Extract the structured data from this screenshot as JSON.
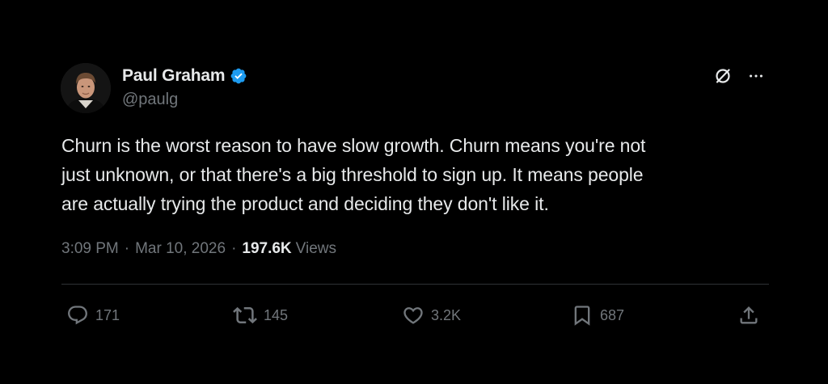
{
  "author": {
    "display_name": "Paul Graham",
    "handle": "@paulg",
    "verified": true
  },
  "tweet": {
    "text": "Churn is the worst reason to have slow growth. Churn means you're not\njust unknown, or that there's a big threshold to sign up. It means people\nare actually trying the product and deciding they don't like it."
  },
  "meta": {
    "time": "3:09 PM",
    "separator": "·",
    "date": "Mar 10, 2026",
    "views_count": "197.6K",
    "views_label": "Views"
  },
  "actions": {
    "replies": "171",
    "reposts": "145",
    "likes": "3.2K",
    "bookmarks": "687"
  },
  "colors": {
    "background": "#000000",
    "text_primary": "#e7e9ea",
    "text_secondary": "#71767b",
    "verified_blue": "#1d9bf0",
    "divider": "#2f3336"
  },
  "icons": [
    "verified-badge-icon",
    "grok-icon",
    "more-icon",
    "reply-icon",
    "repost-icon",
    "like-icon",
    "bookmark-icon",
    "share-icon"
  ]
}
